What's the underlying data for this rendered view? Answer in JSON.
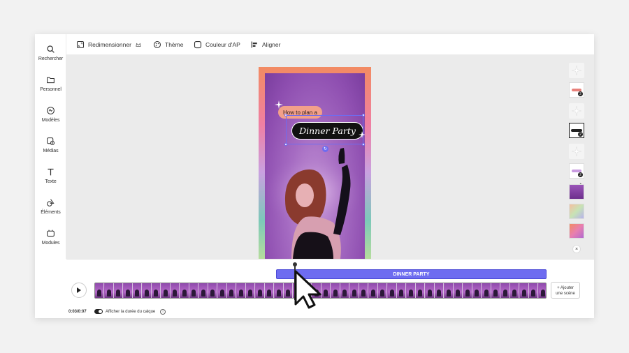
{
  "sidebar": {
    "items": [
      {
        "label": "Rechercher",
        "icon": "search-icon"
      },
      {
        "label": "Personnel",
        "icon": "folder-icon"
      },
      {
        "label": "Modèles",
        "icon": "templates-icon"
      },
      {
        "label": "Médias",
        "icon": "media-icon"
      },
      {
        "label": "Texte",
        "icon": "text-icon"
      },
      {
        "label": "Éléments",
        "icon": "elements-icon"
      },
      {
        "label": "Modules",
        "icon": "modules-icon"
      }
    ]
  },
  "toolbar": {
    "resize_label": "Redimensionner",
    "theme_label": "Thème",
    "bg_color_label": "Couleur d'AP",
    "align_label": "Aligner"
  },
  "canvas": {
    "tag_small": "How to plan a",
    "tag_title": "Dinner Party"
  },
  "thumbnails": {
    "badges": [
      "2",
      "2",
      "2"
    ]
  },
  "timeline": {
    "layer_label": "DINNER PARTY",
    "add_scene_label_line1": "+ Ajouter",
    "add_scene_label_line2": "une scène",
    "time_readout": "0:03/0:07",
    "toggle_label": "Afficher la durée du calque"
  },
  "colors": {
    "accent": "#6e6cf0",
    "canvas_bg": "#ebebeb"
  }
}
